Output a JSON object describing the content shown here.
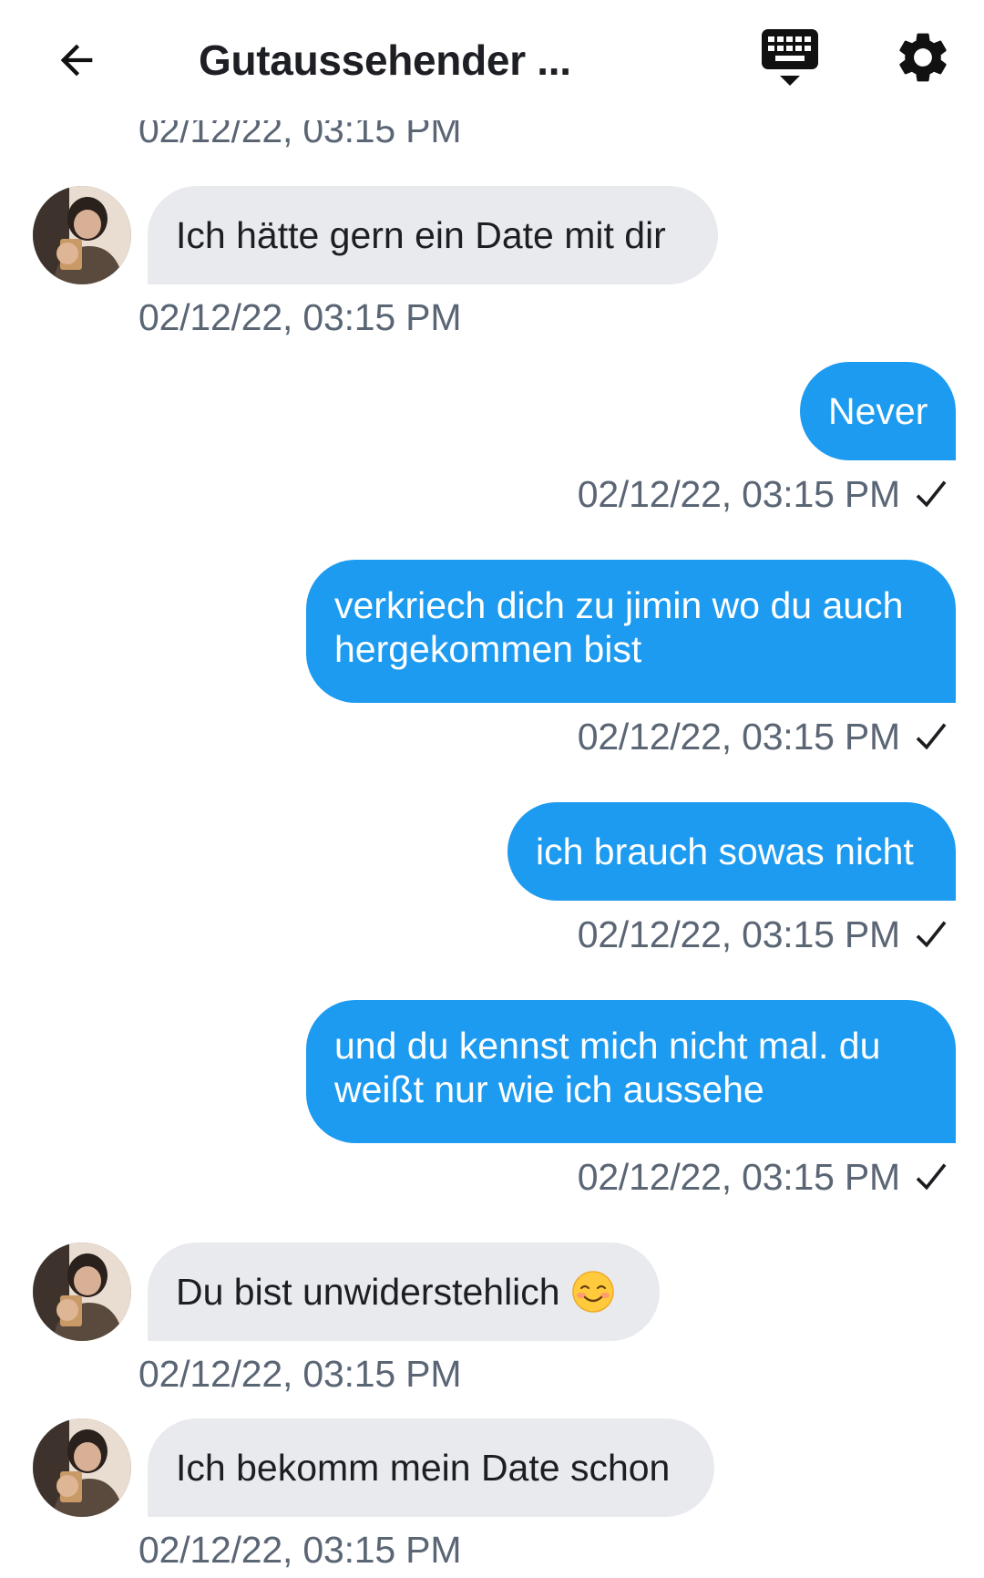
{
  "header": {
    "title": "Gutaussehender ..."
  },
  "messages": [
    {
      "direction": "incoming",
      "text": "Ich hätte gern ein Date mit dir",
      "timestamp": "02/12/22, 03:15 PM"
    },
    {
      "direction": "outgoing",
      "text": "Never",
      "timestamp": "02/12/22, 03:15 PM",
      "status": "sent"
    },
    {
      "direction": "outgoing",
      "text_line1": "verkriech dich zu jimin wo du auch",
      "text_line2": "hergekommen bist",
      "timestamp": "02/12/22, 03:15 PM",
      "status": "sent"
    },
    {
      "direction": "outgoing",
      "text": "ich brauch sowas nicht",
      "timestamp": "02/12/22, 03:15 PM",
      "status": "sent"
    },
    {
      "direction": "outgoing",
      "text_line1": "und du kennst mich nicht mal. du",
      "text_line2": "weißt nur wie ich aussehe",
      "timestamp": "02/12/22, 03:15 PM",
      "status": "sent"
    },
    {
      "direction": "incoming",
      "text": "Du bist unwiderstehlich",
      "emoji": "blushing-smile",
      "timestamp": "02/12/22, 03:15 PM"
    },
    {
      "direction": "incoming",
      "text": "Ich bekomm mein Date schon",
      "timestamp": "02/12/22, 03:15 PM"
    }
  ],
  "partial_top_timestamp": "02/12/22, 03:15 PM",
  "icons": {
    "back": "arrow-left-icon",
    "keyboard": "keyboard-icon",
    "settings": "gear-icon",
    "status": "checkmark-icon"
  },
  "colors": {
    "outgoing_bubble": "#1d9bf0",
    "incoming_bubble": "#e8eaee",
    "timestamp": "#5b6675"
  }
}
